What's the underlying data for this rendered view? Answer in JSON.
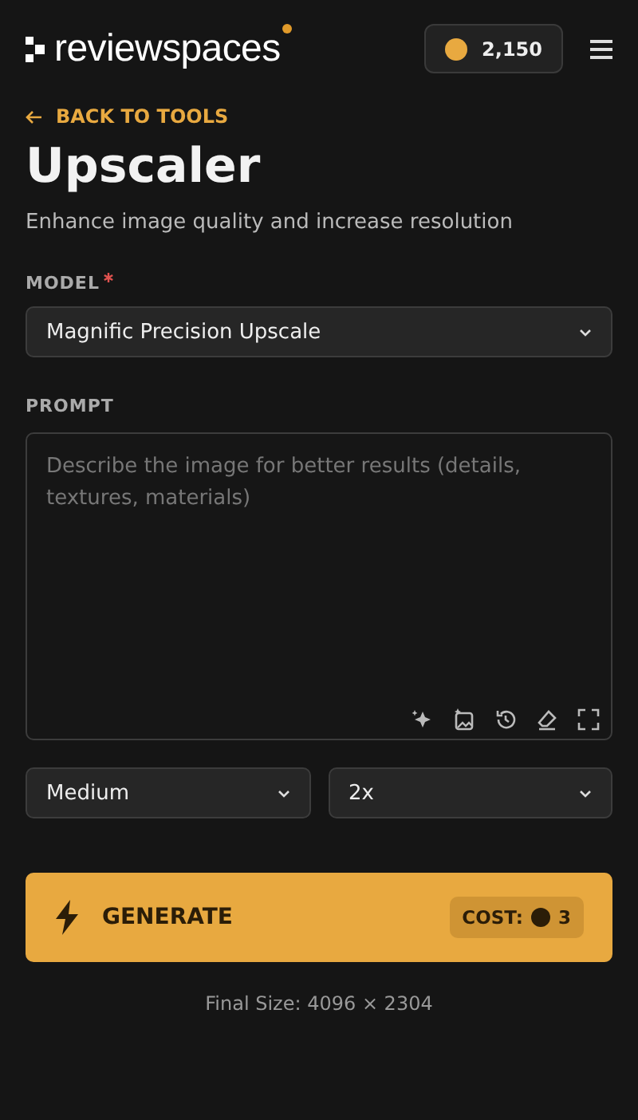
{
  "header": {
    "logo": "review**spaces**",
    "credits": "2,150"
  },
  "back_link": "BACK TO TOOLS",
  "title": "Upscaler",
  "subtitle": "Enhance image quality and increase resolution",
  "model": {
    "label": "MODEL",
    "required": true,
    "value": "Magnific Precision Upscale"
  },
  "prompt": {
    "label": "PROMPT",
    "placeholder": "Describe the image for better results (details, textures, materials)"
  },
  "options": [
    {
      "value": "Medium"
    },
    {
      "value": "2x"
    }
  ],
  "generate": {
    "label": "GENERATE",
    "cost_label": "COST:",
    "cost": "3"
  },
  "final_size": "Final Size: 4096 × 2304"
}
